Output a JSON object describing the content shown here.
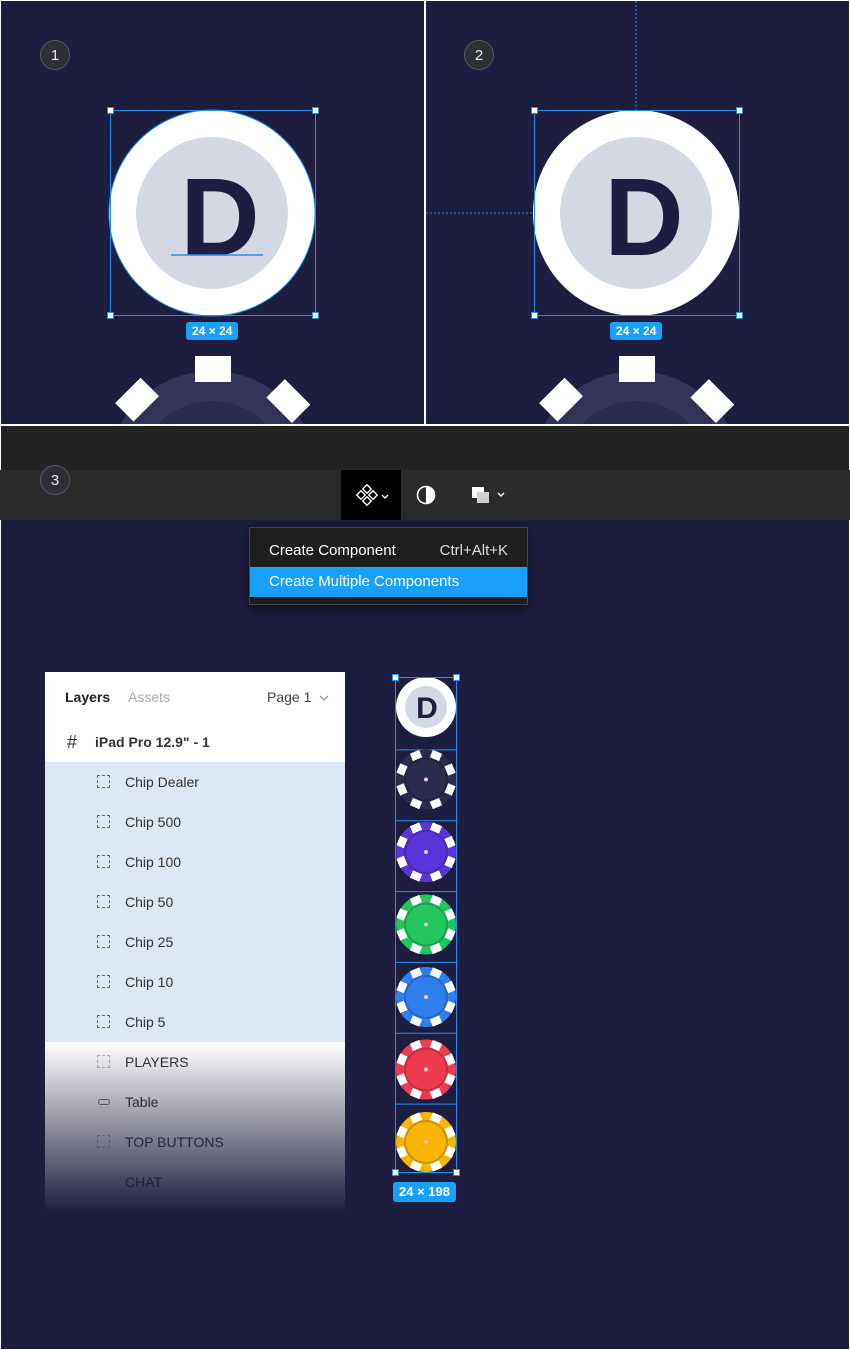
{
  "steps": [
    "1",
    "2",
    "3"
  ],
  "panel1": {
    "dimension": "24 × 24",
    "chip_letter": "D"
  },
  "panel2": {
    "dimension": "24 × 24",
    "chip_letter": "D"
  },
  "toolbar": {
    "component_icon": "component-icon",
    "mask_icon": "mask-icon",
    "boolean_icon": "boolean-icon"
  },
  "menu": {
    "items": [
      {
        "label": "Create Component",
        "shortcut": "Ctrl+Alt+K"
      },
      {
        "label": "Create Multiple Components",
        "shortcut": ""
      }
    ]
  },
  "layers_panel": {
    "tabs": [
      "Layers",
      "Assets"
    ],
    "page": "Page 1",
    "frame": "iPad Pro 12.9\" - 1",
    "rows": [
      "Chip Dealer",
      "Chip 500",
      "Chip 100",
      "Chip 50",
      "Chip 25",
      "Chip 10",
      "Chip 5",
      "PLAYERS",
      "Table",
      "TOP BUTTONS",
      "CHAT"
    ]
  },
  "chip_stack": {
    "dimension": "24 × 198",
    "dealer_letter": "D",
    "chips": [
      {
        "name": "Chip 500",
        "color": "#2b2b4d"
      },
      {
        "name": "Chip 100",
        "color": "#5a34d8"
      },
      {
        "name": "Chip 50",
        "color": "#22c55e"
      },
      {
        "name": "Chip 25",
        "color": "#2f80ed"
      },
      {
        "name": "Chip 10",
        "color": "#ef3b4f"
      },
      {
        "name": "Chip 5",
        "color": "#f7b500"
      }
    ]
  },
  "colors": {
    "canvas": "#1d1d3f",
    "accent": "#18a0fb",
    "selection": "#dbe8f5"
  }
}
